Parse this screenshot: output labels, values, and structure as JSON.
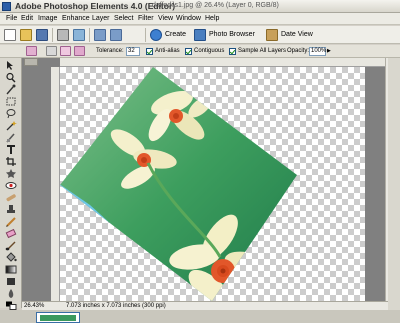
{
  "title_bar": {
    "app_title": "Adobe Photoshop Elements 4.0 (Editor)",
    "document": "daffodils1.jpg @ 26.4% (Layer 0, RGB/8)"
  },
  "menu": [
    "File",
    "Edit",
    "Image",
    "Enhance",
    "Layer",
    "Select",
    "Filter",
    "View",
    "Window",
    "Help"
  ],
  "toolbar": {
    "create_label": "Create",
    "photo_browser_label": "Photo Browser",
    "date_view_label": "Date View"
  },
  "options_bar": {
    "tolerance_label": "Tolerance:",
    "tolerance_value": "32",
    "anti_alias_label": "Anti-alias",
    "contiguous_label": "Contiguous",
    "sample_all_layers_label": "Sample All Layers",
    "opacity_label": "Opacity:",
    "opacity_value": "100%"
  },
  "status_bar": {
    "zoom": "26.43%",
    "doc_info": "7.073 inches x 7.073 inches (300 ppi)"
  },
  "colors": {
    "photo_green": "#3a9a5c",
    "flower_petal": "#f3efc8",
    "flower_center": "#e2572a",
    "accent_blue": "#6ec6e8"
  }
}
